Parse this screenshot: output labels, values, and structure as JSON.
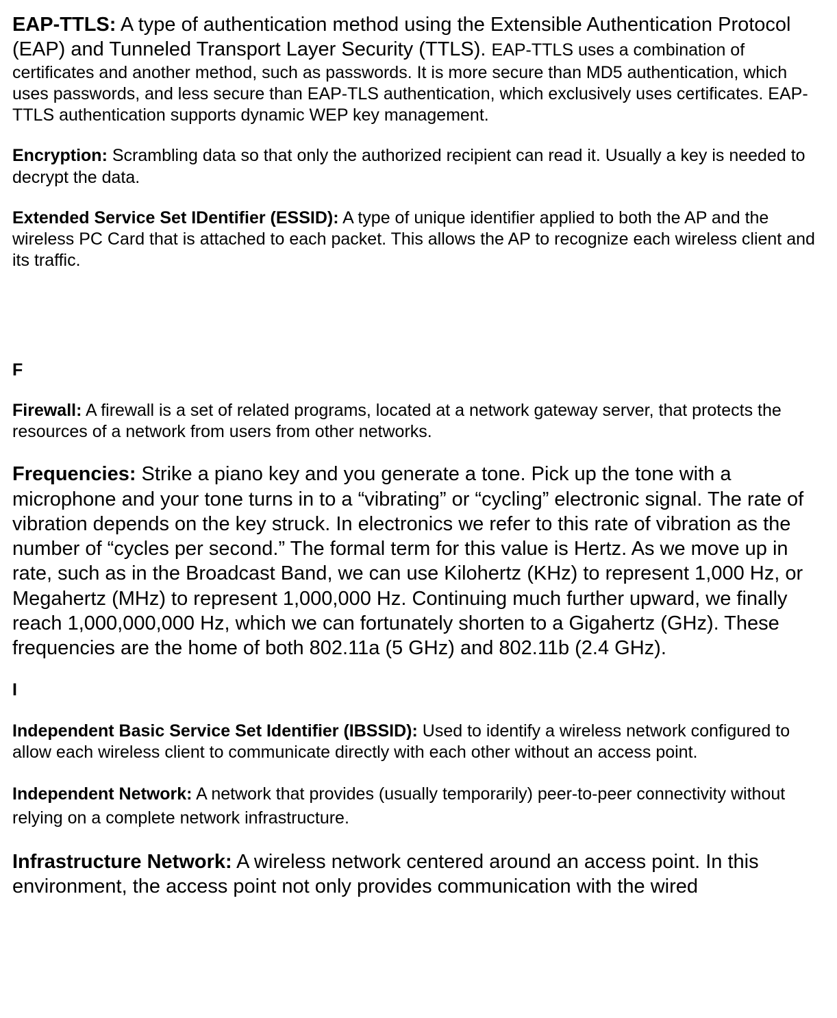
{
  "entries": {
    "eap_ttls": {
      "term": "EAP-TTLS:",
      "def_large": " A type of authentication method using the Extensible Authentication Protocol (EAP) and Tunneled Transport Layer Security (TTLS). ",
      "def_small": "EAP-TTLS uses a combination of certificates and another method, such as passwords. It is more secure than MD5 authentication, which uses passwords, and less secure than EAP-TLS authentication, which exclusively uses certificates. EAP-TTLS authentication supports dynamic WEP key management."
    },
    "encryption": {
      "term": "Encryption:",
      "def": " Scrambling data so that only the authorized recipient can read it. Usually a key is needed to decrypt the data."
    },
    "essid": {
      "term": "Extended Service Set IDentifier (ESSID):",
      "def": " A type of unique identifier applied to both the AP and the wireless PC Card that is attached to each packet. This allows the AP to recognize each wireless client and its traffic."
    },
    "firewall": {
      "term": "Firewall:",
      "def": " A firewall is a set of related programs, located at a network gateway server, that protects the resources of a network from users from other networks."
    },
    "frequencies": {
      "term": "Frequencies:",
      "def": " Strike a piano key and you generate a tone. Pick up the tone with a microphone and your tone turns in to a “vibrating” or “cycling” electronic signal. The rate of vibration depends on the key struck. In electronics we refer to this rate of vibration as the number of “cycles per second.” The formal term for this value is Hertz. As we move up in rate, such as in the Broadcast Band, we can use Kilohertz (KHz) to represent 1,000 Hz, or Megahertz (MHz) to represent 1,000,000 Hz. Continuing much further upward, we finally reach 1,000,000,000 Hz, which we can fortunately shorten to a Gigahertz (GHz). These frequencies are the home of both 802.11a (5 GHz) and 802.11b (2.4 GHz)."
    },
    "ibssid": {
      "term": "Independent Basic Service Set Identifier (IBSSID):",
      "def": " Used to identify a wireless network configured to allow each wireless client to communicate directly with each other without an access point."
    },
    "independent_network": {
      "term": "Independent Network:",
      "def": " A network that provides (usually temporarily) peer-to-peer connectivity without relying on a complete network infrastructure."
    },
    "infrastructure_network": {
      "term": "Infrastructure Network:",
      "def": " A wireless network centered around an access point. In this environment, the access point not only provides communication with the wired"
    }
  },
  "sections": {
    "f": "F",
    "i": "I"
  }
}
